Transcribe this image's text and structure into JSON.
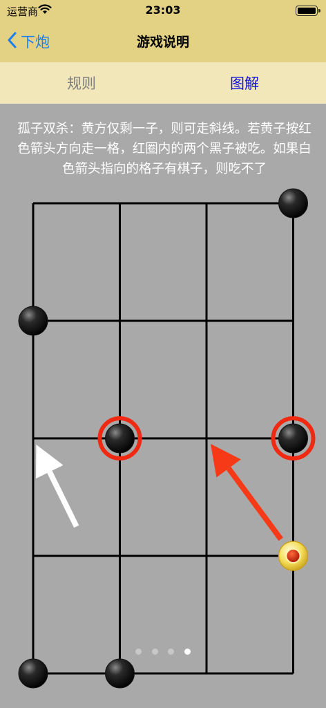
{
  "status": {
    "carrier": "运营商",
    "time": "23:03"
  },
  "nav": {
    "back_label": "下炮",
    "title": "游戏说明"
  },
  "tabs": [
    {
      "label": "规则",
      "selected": false
    },
    {
      "label": "图解",
      "selected": true
    }
  ],
  "description": "孤子双杀：黄方仅剩一子，则可走斜线。若黄子按红色箭头方向走一格，红圈内的两个黑子被吃。如果白色箭头指向的格子有棋子，则吃不了",
  "board": {
    "columns": 4,
    "rows": 5,
    "pieces": [
      {
        "col": 3,
        "row": 0,
        "color": "black",
        "circled": false
      },
      {
        "col": 0,
        "row": 1,
        "color": "black",
        "circled": false
      },
      {
        "col": 1,
        "row": 2,
        "color": "black",
        "circled": true
      },
      {
        "col": 3,
        "row": 2,
        "color": "black",
        "circled": true
      },
      {
        "col": 3,
        "row": 3,
        "color": "yellow",
        "circled": false
      },
      {
        "col": 0,
        "row": 4,
        "color": "black",
        "circled": false
      },
      {
        "col": 1,
        "row": 4,
        "color": "black",
        "circled": false
      }
    ],
    "arrows": [
      {
        "color": "red",
        "from": {
          "col": 3,
          "row": 3
        },
        "to_node": {
          "col": 2,
          "row": 2
        }
      },
      {
        "color": "white",
        "from": {
          "col": 0.5,
          "row": 2.75
        },
        "to_node": {
          "col": 0,
          "row": 2
        }
      }
    ]
  },
  "pager": {
    "count": 4,
    "current": 4
  },
  "colors": {
    "bar": "#e3d184",
    "tabbar": "#f1e7b9",
    "background": "#a9a9a9",
    "accent_blue": "#1a7ef0",
    "circle_red": "#f02a12",
    "arrow_red": "#f63a18",
    "arrow_white": "#ffffff"
  }
}
